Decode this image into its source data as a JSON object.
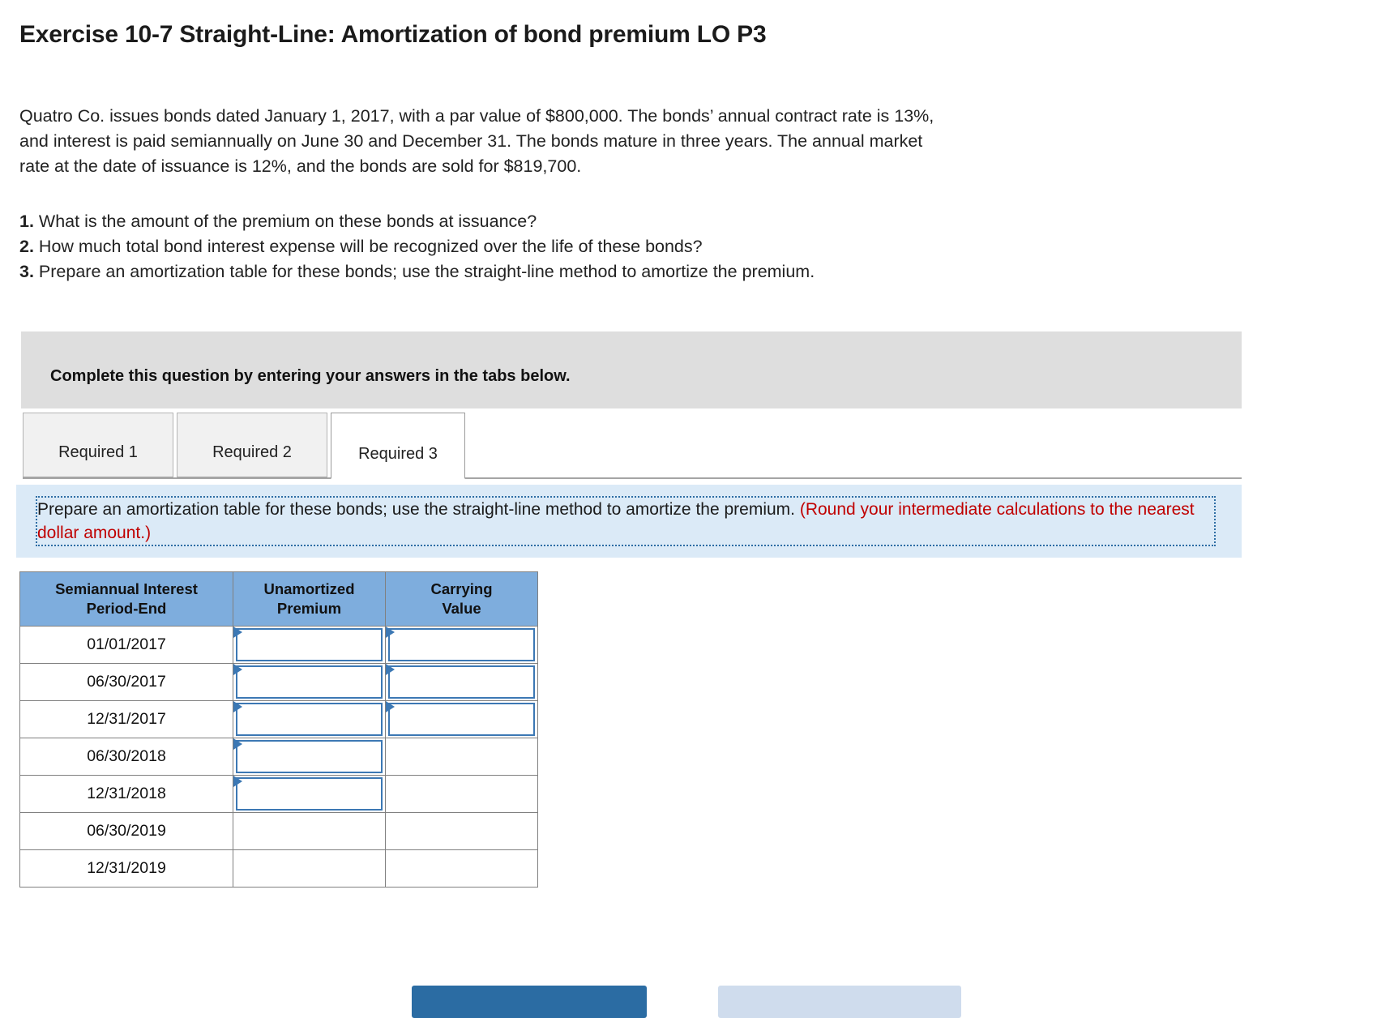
{
  "title": "Exercise 10-7 Straight-Line: Amortization of bond premium LO P3",
  "problem": {
    "line1": "Quatro Co. issues bonds dated January 1, 2017, with a par value of $800,000. The bonds’ annual contract rate is 13%,",
    "line2": "and interest is paid semiannually on June 30 and December 31. The bonds mature in three years. The annual market",
    "line3": "rate at the date of issuance is 12%, and the bonds are sold for $819,700."
  },
  "questions": [
    {
      "num": "1.",
      "text": "What is the amount of the premium on these bonds at issuance?"
    },
    {
      "num": "2.",
      "text": "How much total bond interest expense will be recognized over the life of these bonds?"
    },
    {
      "num": "3.",
      "text": "Prepare an amortization table for these bonds; use the straight-line method to amortize the premium."
    }
  ],
  "instruction_bar": {
    "text": "Complete this question by entering your answers in the tabs below."
  },
  "tabs": [
    {
      "label": "Required 1",
      "active": false
    },
    {
      "label": "Required 2",
      "active": false
    },
    {
      "label": "Required 3",
      "active": true
    }
  ],
  "blue_panel": {
    "main_text": "Prepare an amortization table for these bonds; use the straight-line method to amortize the premium. ",
    "red_text": "(Round your intermediate calculations to the nearest dollar amount.)"
  },
  "table": {
    "headers": [
      "Semiannual Interest Period-End",
      "Unamortized Premium",
      "Carrying Value"
    ],
    "header_lines": [
      [
        "Semiannual Interest",
        "Period-End"
      ],
      [
        "Unamortized",
        "Premium"
      ],
      [
        "Carrying",
        "Value"
      ]
    ],
    "rows": [
      {
        "date": "01/01/2017",
        "premium": "",
        "carrying": "",
        "premium_input": true,
        "carrying_input": true
      },
      {
        "date": "06/30/2017",
        "premium": "",
        "carrying": "",
        "premium_input": true,
        "carrying_input": true
      },
      {
        "date": "12/31/2017",
        "premium": "",
        "carrying": "",
        "premium_input": true,
        "carrying_input": true
      },
      {
        "date": "06/30/2018",
        "premium": "",
        "carrying": "",
        "premium_input": true,
        "carrying_input": false
      },
      {
        "date": "12/31/2018",
        "premium": "",
        "carrying": "",
        "premium_input": true,
        "carrying_input": false
      },
      {
        "date": "06/30/2019",
        "premium": "",
        "carrying": "",
        "premium_input": false,
        "carrying_input": false
      },
      {
        "date": "12/31/2019",
        "premium": "",
        "carrying": "",
        "premium_input": false,
        "carrying_input": false
      }
    ]
  },
  "buttons": [
    {
      "label": "",
      "name": "previous-button"
    },
    {
      "label": "",
      "name": "next-button"
    }
  ],
  "colors": {
    "header_blue": "#7eaddd",
    "panel_blue": "#dbeaf7",
    "dash_border": "#2e6da4",
    "red": "#c00000",
    "gray_bar": "#dedede",
    "input_border": "#3c78b4"
  }
}
